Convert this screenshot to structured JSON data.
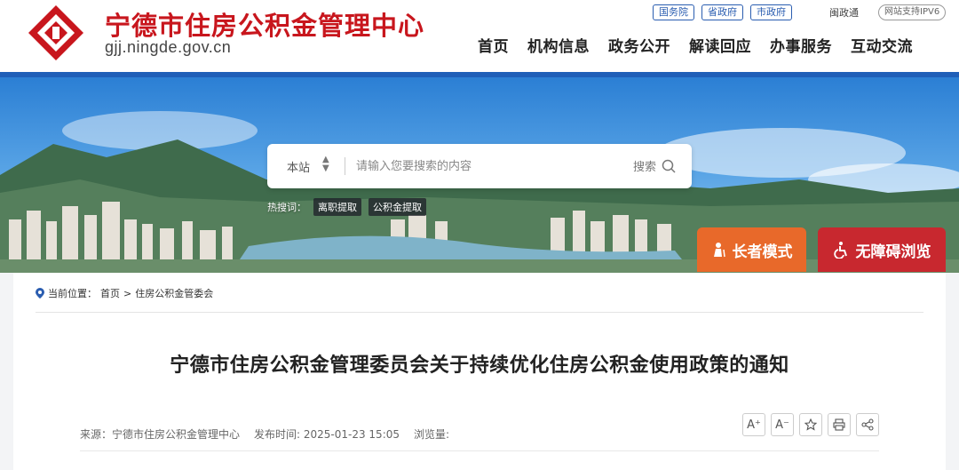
{
  "header": {
    "site_name": "宁德市住房公积金管理中心",
    "domain": "gjj.ningde.gov.cn",
    "top_links": [
      "国务院",
      "省政府",
      "市政府"
    ],
    "min_tong": "闽政通",
    "ipv6": "网站支持IPV6",
    "nav": [
      "首页",
      "机构信息",
      "政务公开",
      "解读回应",
      "办事服务",
      "互动交流"
    ],
    "brand_color": "#c8161d",
    "accent_color": "#1f5fb8"
  },
  "search": {
    "scope": "本站",
    "placeholder": "请输入您要搜索的内容",
    "button_label": "搜索",
    "hot_label": "热搜词：",
    "hot_tags": [
      "离职提取",
      "公积金提取"
    ]
  },
  "modes": {
    "elder": "长者模式",
    "accessible": "无障碍浏览"
  },
  "breadcrumb": {
    "label": "当前位置：",
    "home": "首页",
    "sep": ">",
    "current": "住房公积金管委会"
  },
  "article": {
    "title": "宁德市住房公积金管理委员会关于持续优化住房公积金使用政策的通知",
    "source": "来源：宁德市住房公积金管理中心",
    "published": "发布时间: 2025-01-23 15:05",
    "views": "浏览量:"
  },
  "tools": {
    "font_up": "A⁺",
    "font_down": "A⁻",
    "favorite_icon": "star-icon",
    "print_icon": "printer-icon",
    "share_icon": "share-icon"
  }
}
